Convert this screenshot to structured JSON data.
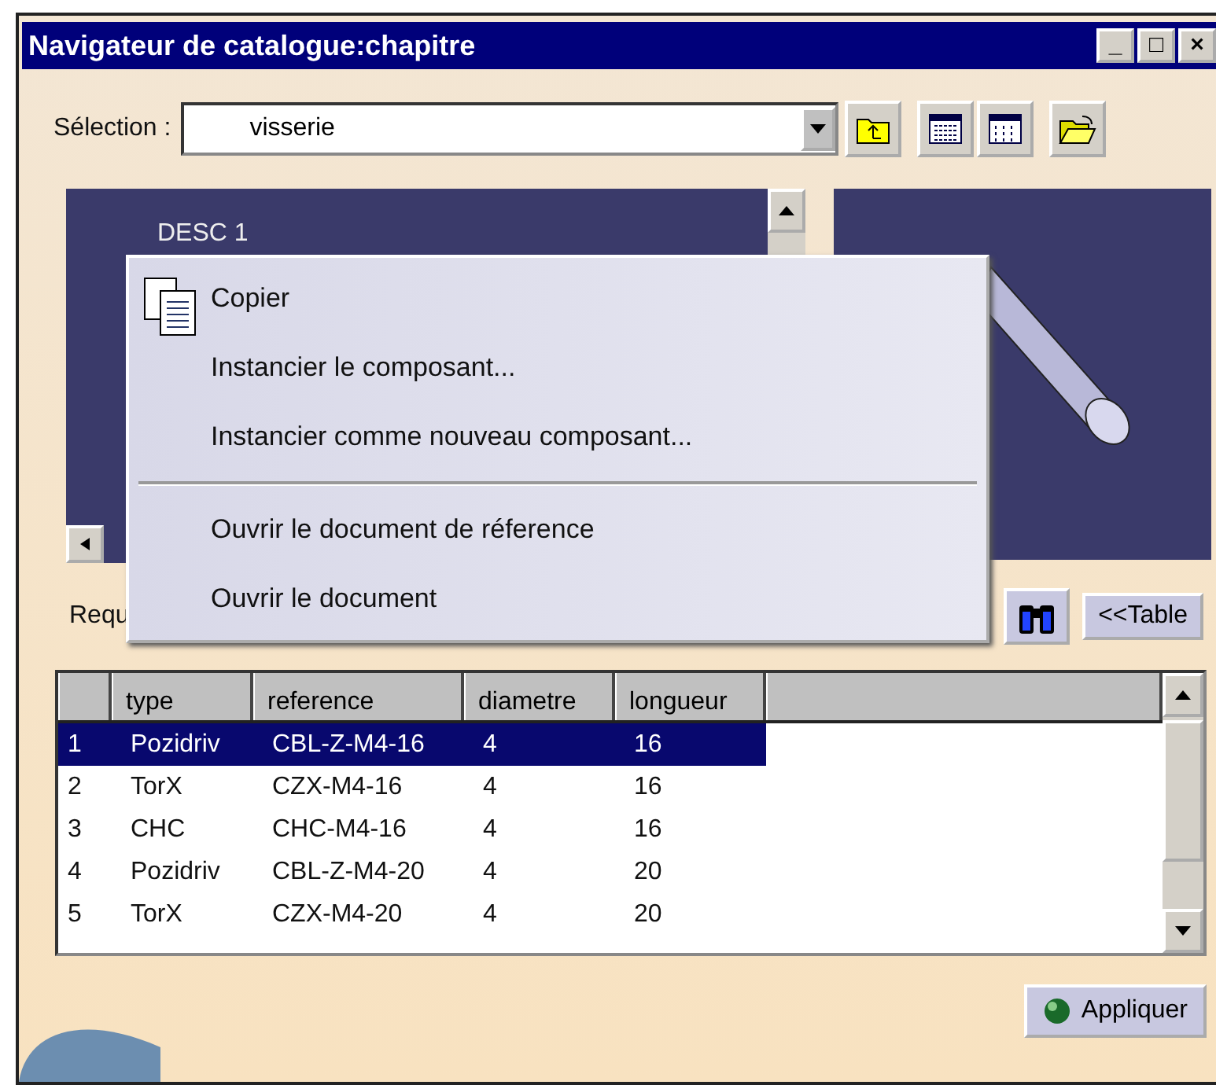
{
  "window": {
    "title": "Navigateur de catalogue:chapitre",
    "controls": [
      "_",
      "□",
      "×"
    ]
  },
  "selection": {
    "label": "Sélection :",
    "value": "visserie"
  },
  "tree": {
    "items": [
      {
        "label": "DESC 1"
      }
    ]
  },
  "query": {
    "label": "Requ",
    "table_button": "<<Table"
  },
  "context_menu": {
    "items": [
      {
        "kind": "item",
        "label": "Copier",
        "icon": true
      },
      {
        "kind": "item",
        "label": "Instancier le composant...",
        "icon": false
      },
      {
        "kind": "item",
        "label": "Instancier comme nouveau composant...",
        "icon": false
      },
      {
        "kind": "separator"
      },
      {
        "kind": "item",
        "label": "Ouvrir le document de réference",
        "icon": false
      },
      {
        "kind": "item",
        "label": "Ouvrir le document",
        "icon": false
      }
    ]
  },
  "table": {
    "columns": [
      "type",
      "reference",
      "diametre",
      "longueur"
    ],
    "rows": [
      {
        "index": "1",
        "cells": [
          "Pozidriv",
          "CBL-Z-M4-16",
          "4",
          "16"
        ],
        "selected": true
      },
      {
        "index": "2",
        "cells": [
          "TorX",
          "CZX-M4-16",
          "4",
          "16"
        ],
        "selected": false
      },
      {
        "index": "3",
        "cells": [
          "CHC",
          "CHC-M4-16",
          "4",
          "16"
        ],
        "selected": false
      },
      {
        "index": "4",
        "cells": [
          "Pozidriv",
          "CBL-Z-M4-20",
          "4",
          "20"
        ],
        "selected": false
      },
      {
        "index": "5",
        "cells": [
          "TorX",
          "CZX-M4-20",
          "4",
          "20"
        ],
        "selected": false
      }
    ]
  },
  "apply_button": "Appliquer"
}
